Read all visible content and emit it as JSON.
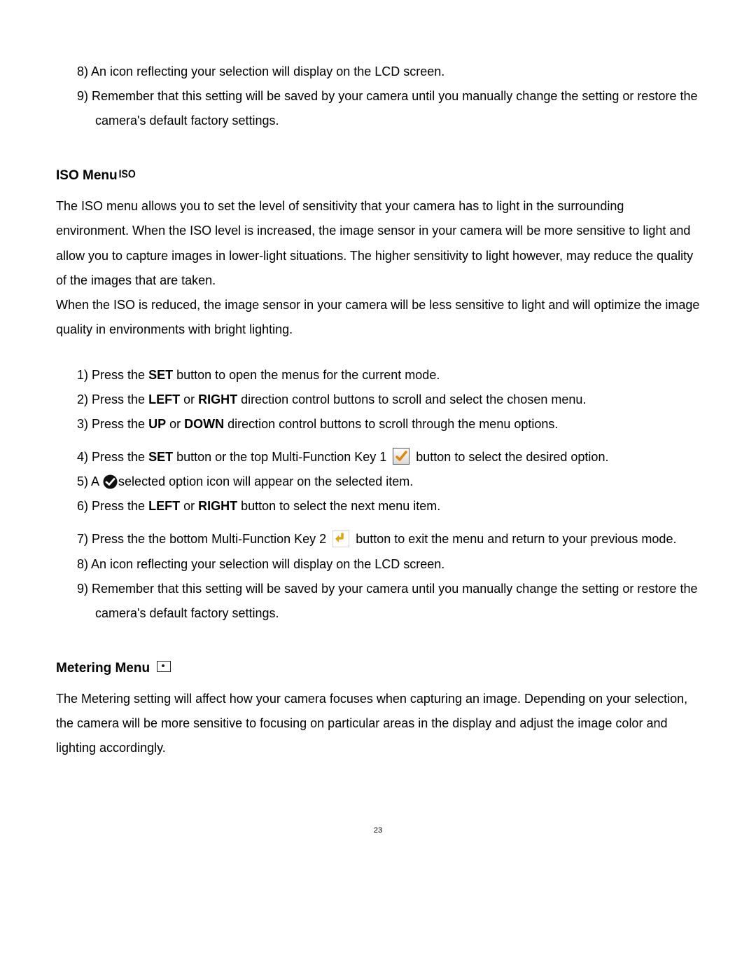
{
  "top_list": {
    "i8": {
      "num": "8)",
      "text": "An icon reflecting your selection will display on the LCD screen."
    },
    "i9": {
      "num": "9)",
      "text": "Remember that this setting will be saved by your camera until you manually change the setting or restore the camera's default factory settings."
    }
  },
  "iso_heading": "ISO Menu",
  "iso_icon_label": "ISO",
  "iso_para": "The ISO menu allows you to set the level of sensitivity that your camera has to light in the surrounding environment. When the ISO level is increased, the image sensor in your camera will be more sensitive to light and allow you to capture images in lower-light situations. The higher sensitivity to light however, may reduce the quality of the images that are taken.",
  "iso_para2": "When the ISO is reduced, the image sensor in your camera will be less sensitive to light and will optimize the image quality in environments with bright lighting.",
  "steps": {
    "s1": {
      "num": "1)",
      "a": "Press the ",
      "set": "SET",
      "b": " button to open the menus for the current mode."
    },
    "s2": {
      "num": "2)",
      "a": "Press the ",
      "left": "LEFT",
      "or": " or ",
      "right": "RIGHT",
      "b": " direction control buttons to scroll and select the chosen menu."
    },
    "s3": {
      "num": "3)",
      "a": "Press the ",
      "up": "UP",
      "or": " or ",
      "down": "DOWN",
      "b": " direction control buttons to scroll through the menu options."
    },
    "s4": {
      "num": "4)",
      "a": "Press the ",
      "set": "SET",
      "b": " button or the top Multi-Function Key 1 ",
      "c": " button to select the desired option."
    },
    "s5": {
      "num": "5)",
      "a": "A ",
      "b": "selected option icon will appear on the selected item."
    },
    "s6": {
      "num": "6)",
      "a": "Press the ",
      "left": "LEFT",
      "or": " or ",
      "right": "RIGHT",
      "b": " button to select the next menu item."
    },
    "s7": {
      "num": "7)",
      "a": "Press the the bottom Multi-Function Key 2 ",
      "b": " button to exit the menu and return to your previous mode."
    },
    "s8": {
      "num": "8)",
      "text": "An icon reflecting your selection will display on the LCD screen."
    },
    "s9": {
      "num": "9)",
      "text": "Remember that this setting will be saved by your camera until you manually change the setting or restore the camera's default factory settings."
    }
  },
  "metering_heading": "Metering Menu",
  "metering_para": "The Metering setting will affect how your camera focuses when capturing an image. Depending on your selection, the camera will be more sensitive to focusing on particular areas in the display and adjust the image color and lighting accordingly.",
  "page_number": "23"
}
